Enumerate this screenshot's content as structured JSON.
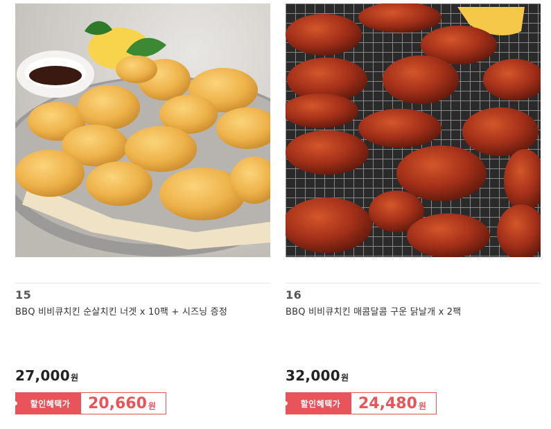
{
  "products": [
    {
      "number": "15",
      "title": "BBQ 비비큐치킨 순살치킨 너겟 x 10팩 + 시즈닝 증정",
      "price": "27,000",
      "price_unit": "원",
      "sale_label": "할인혜택가",
      "sale_price": "20,660",
      "sale_unit": "원",
      "image_alt": "chicken nuggets on a plate with dipping sauce"
    },
    {
      "number": "16",
      "title": "BBQ 비비큐치킨 매콤달콤 구운 닭날개 x 2팩",
      "price": "32,000",
      "price_unit": "원",
      "sale_label": "할인혜택가",
      "sale_price": "24,480",
      "sale_unit": "원",
      "image_alt": "grilled glazed chicken wings on a wire rack"
    }
  ],
  "colors": {
    "accent": "#e9545a",
    "price_text": "#222222",
    "title_text": "#333333",
    "number_text": "#555555",
    "divider": "#e6e6e6"
  }
}
